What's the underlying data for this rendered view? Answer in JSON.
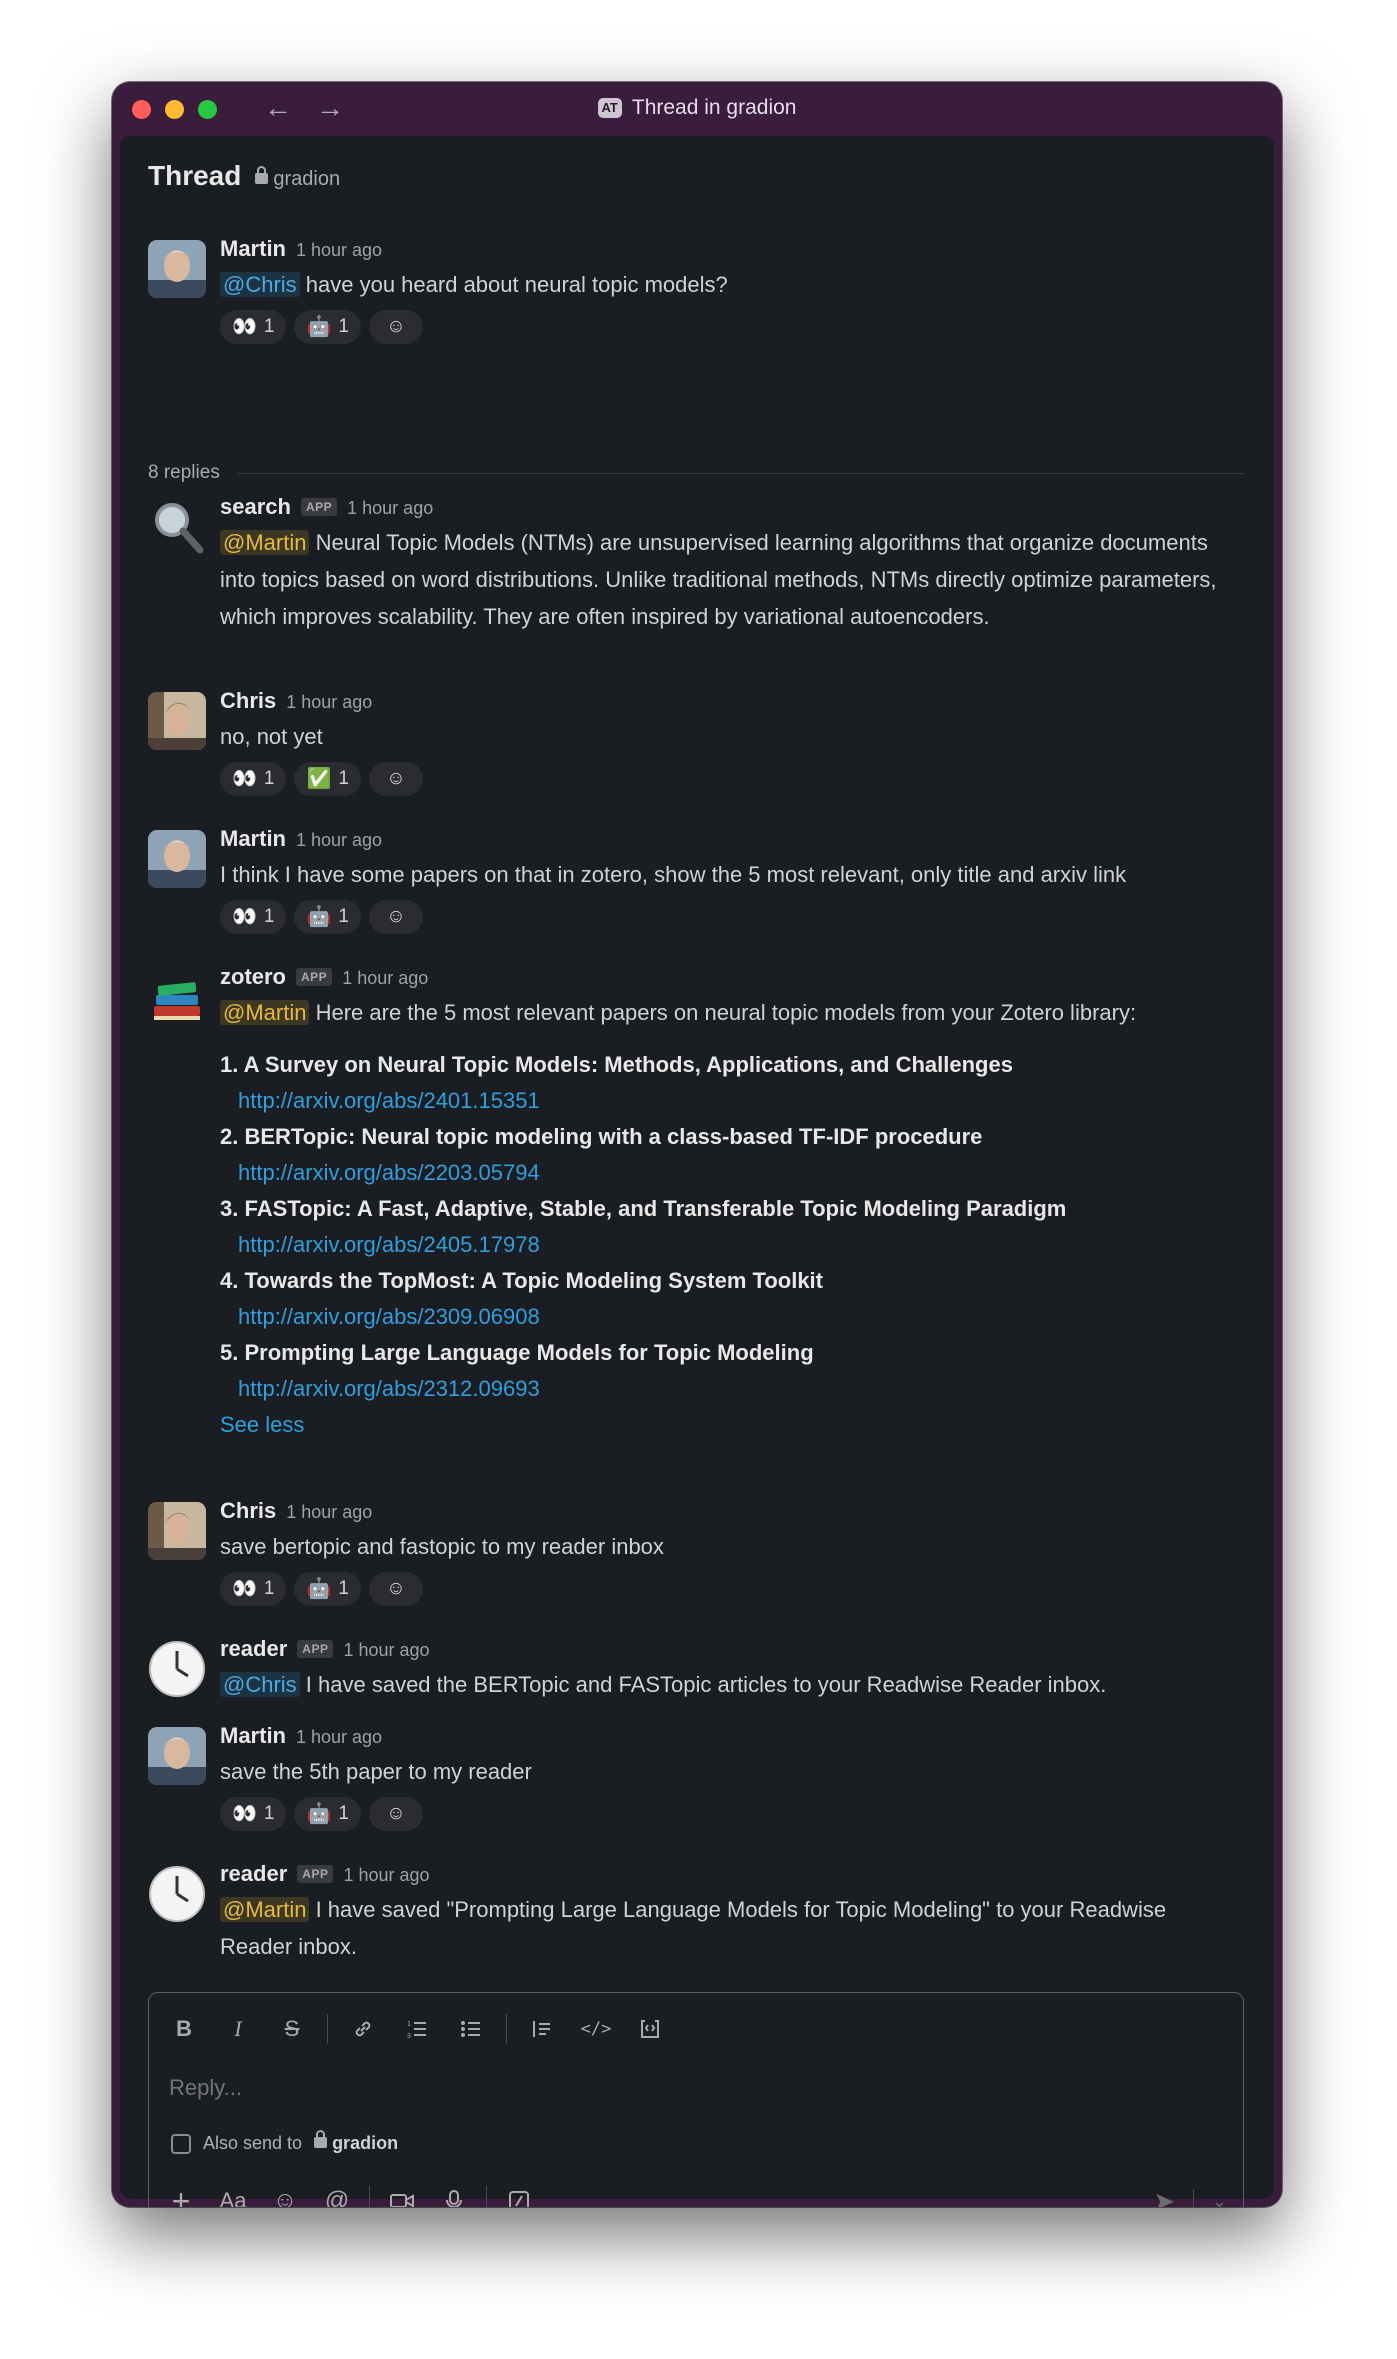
{
  "window": {
    "title": "Thread in gradion",
    "workspace_badge": "AT"
  },
  "header": {
    "title": "Thread",
    "channel": "gradion"
  },
  "root": {
    "name": "Martin",
    "time": "1 hour ago",
    "mention": "@Chris",
    "text": " have you heard about neural topic models?",
    "reactions": [
      {
        "emoji": "👀",
        "count": "1"
      },
      {
        "emoji": "🤖",
        "count": "1"
      }
    ]
  },
  "replies_label": "8 replies",
  "messages": [
    {
      "name": "search",
      "app": "APP",
      "time": "1 hour ago",
      "mention": "@Martin",
      "text": " Neural Topic Models (NTMs) are unsupervised learning algorithms that organize documents into topics based on word distributions. Unlike traditional methods, NTMs directly optimize parameters, which improves scalability. They are often inspired by variational autoencoders."
    },
    {
      "name": "Chris",
      "time": "1 hour ago",
      "text": "no, not yet",
      "reactions": [
        {
          "emoji": "👀",
          "count": "1"
        },
        {
          "emoji": "✅",
          "count": "1"
        }
      ]
    },
    {
      "name": "Martin",
      "time": "1 hour ago",
      "text": "I think I have some papers on that in zotero, show the 5 most relevant, only title and arxiv link",
      "reactions": [
        {
          "emoji": "👀",
          "count": "1"
        },
        {
          "emoji": "🤖",
          "count": "1"
        }
      ]
    },
    {
      "name": "zotero",
      "app": "APP",
      "time": "1 hour ago",
      "mention": "@Martin",
      "text": " Here are the 5 most relevant papers on neural topic models from your Zotero library:",
      "papers": [
        {
          "num": "1.",
          "title": "A Survey on Neural Topic Models: Methods, Applications, and Challenges",
          "link": "http://arxiv.org/abs/2401.15351"
        },
        {
          "num": "2.",
          "title": "BERTopic: Neural topic modeling with a class-based TF-IDF procedure",
          "link": "http://arxiv.org/abs/2203.05794"
        },
        {
          "num": "3.",
          "title": "FASTopic: A Fast, Adaptive, Stable, and Transferable Topic Modeling Paradigm",
          "link": "http://arxiv.org/abs/2405.17978"
        },
        {
          "num": "4.",
          "title": "Towards the TopMost: A Topic Modeling System Toolkit",
          "link": "http://arxiv.org/abs/2309.06908"
        },
        {
          "num": "5.",
          "title": "Prompting Large Language Models for Topic Modeling",
          "link": "http://arxiv.org/abs/2312.09693"
        }
      ],
      "see_less": "See less"
    },
    {
      "name": "Chris",
      "time": "1 hour ago",
      "text": "save bertopic and fastopic to my reader inbox",
      "reactions": [
        {
          "emoji": "👀",
          "count": "1"
        },
        {
          "emoji": "🤖",
          "count": "1"
        }
      ]
    },
    {
      "name": "reader",
      "app": "APP",
      "time": "1 hour ago",
      "mention": "@Chris",
      "text": " I have saved the BERTopic and FASTopic articles to your Readwise Reader inbox."
    },
    {
      "name": "Martin",
      "time": "1 hour ago",
      "text": "save the 5th paper to my reader",
      "reactions": [
        {
          "emoji": "👀",
          "count": "1"
        },
        {
          "emoji": "🤖",
          "count": "1"
        }
      ]
    },
    {
      "name": "reader",
      "app": "APP",
      "time": "1 hour ago",
      "mention": "@Martin",
      "text": " I have saved \"Prompting Large Language Models for Topic Modeling\" to your Readwise Reader inbox."
    }
  ],
  "composer": {
    "placeholder": "Reply...",
    "also_send": "Also send to",
    "channel": "gradion",
    "format_buttons": [
      "bold-icon",
      "italic-icon",
      "strikethrough-icon",
      "link-icon",
      "ordered-list-icon",
      "bulleted-list-icon",
      "blockquote-icon",
      "code-icon",
      "code-block-icon"
    ]
  }
}
